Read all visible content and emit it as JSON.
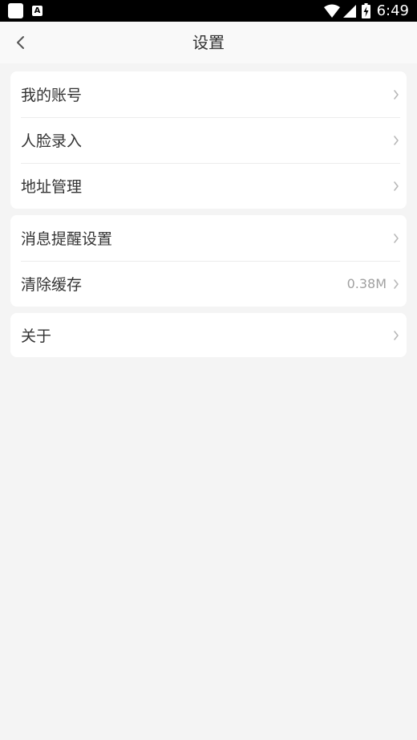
{
  "status_bar": {
    "time": "6:49",
    "notification_icons": [
      "app-square-icon",
      "a-box-icon"
    ],
    "system_icons": [
      "wifi-icon",
      "signal-icon",
      "battery-icon"
    ]
  },
  "header": {
    "title": "设置",
    "back_icon": "chevron-left-icon"
  },
  "groups": [
    {
      "items": [
        {
          "label": "我的账号"
        },
        {
          "label": "人脸录入"
        },
        {
          "label": "地址管理"
        }
      ]
    },
    {
      "items": [
        {
          "label": "消息提醒设置"
        },
        {
          "label": "清除缓存",
          "value": "0.38M"
        }
      ]
    },
    {
      "items": [
        {
          "label": "关于"
        }
      ]
    }
  ],
  "colors": {
    "background": "#f4f4f4",
    "card": "#ffffff",
    "text": "#333333",
    "secondary_text": "#a0a0a0",
    "status_bar": "#000000"
  }
}
